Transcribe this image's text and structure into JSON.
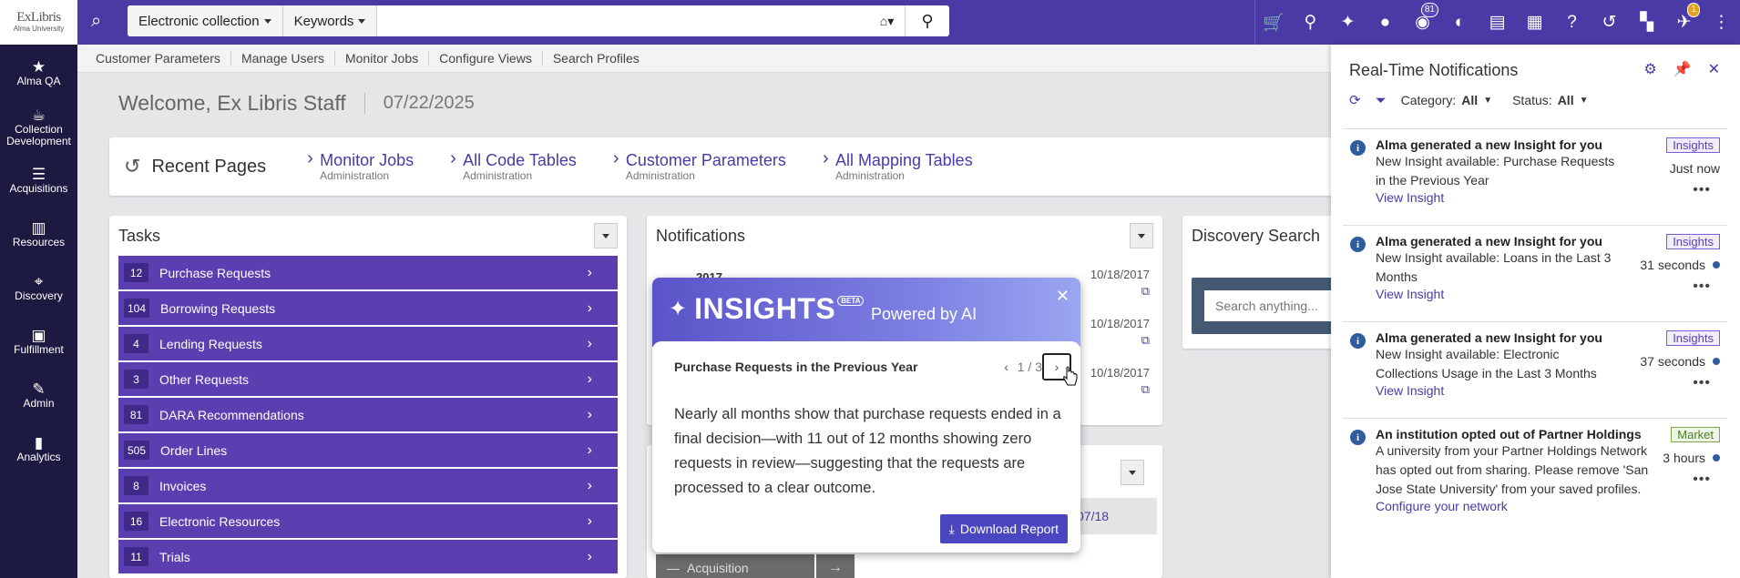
{
  "logo": {
    "line1": "ExLibris",
    "line2": "Alma University"
  },
  "search": {
    "scope": "Electronic collection",
    "field": "Keywords",
    "home": "⌂▾",
    "query": "",
    "placeholder": ""
  },
  "top_badges": {
    "tasks": "81",
    "notifications": "1"
  },
  "sidebar": {
    "items": [
      {
        "label": "Alma QA",
        "icon": "★"
      },
      {
        "label": "Collection Development",
        "icon": "☕"
      },
      {
        "label": "Acquisitions",
        "icon": "☰"
      },
      {
        "label": "Resources",
        "icon": "▥"
      },
      {
        "label": "Discovery",
        "icon": "⌖"
      },
      {
        "label": "Fulfillment",
        "icon": "▣"
      },
      {
        "label": "Admin",
        "icon": "✎"
      },
      {
        "label": "Analytics",
        "icon": "▮"
      }
    ]
  },
  "subnav": [
    "Customer Parameters",
    "Manage Users",
    "Monitor Jobs",
    "Configure Views",
    "Search Profiles"
  ],
  "welcome": {
    "text": "Welcome, Ex Libris Staff",
    "date": "07/22/2025"
  },
  "recent": {
    "title": "Recent Pages",
    "links": [
      {
        "title": "Monitor Jobs",
        "sub": "Administration"
      },
      {
        "title": "All Code Tables",
        "sub": "Administration"
      },
      {
        "title": "Customer Parameters",
        "sub": "Administration"
      },
      {
        "title": "All Mapping Tables",
        "sub": "Administration"
      }
    ]
  },
  "tasks": {
    "title": "Tasks",
    "items": [
      {
        "count": "12",
        "label": "Purchase Requests"
      },
      {
        "count": "104",
        "label": "Borrowing Requests"
      },
      {
        "count": "4",
        "label": "Lending Requests"
      },
      {
        "count": "3",
        "label": "Other Requests"
      },
      {
        "count": "81",
        "label": "DARA Recommendations"
      },
      {
        "count": "505",
        "label": "Order Lines"
      },
      {
        "count": "8",
        "label": "Invoices"
      },
      {
        "count": "16",
        "label": "Electronic Resources"
      },
      {
        "count": "11",
        "label": "Trials"
      }
    ]
  },
  "notifications": {
    "title": "Notifications",
    "year": "2017",
    "dates": [
      "10/18/2017",
      "10/18/2017",
      "10/18/2017"
    ],
    "date2": "07/18",
    "acq": "Acquisition"
  },
  "discovery": {
    "title": "Discovery Search",
    "placeholder": "Search anything..."
  },
  "insights": {
    "brand": "INSIGHTS",
    "beta": "BETA",
    "powered": "Powered by AI",
    "close": "✕",
    "subtitle": "Purchase Requests in the Previous Year",
    "page": "1 / 3",
    "body": "Nearly all months show that purchase requests ended in a final decision—with 11 out of 12 months showing zero requests in review—suggesting that the requests are processed to a clear outcome.",
    "download": "Download Report"
  },
  "rt": {
    "title": "Real-Time Notifications",
    "category_label": "Category:",
    "category_value": "All",
    "status_label": "Status:",
    "status_value": "All",
    "items": [
      {
        "head": "Alma generated a new Insight for you",
        "body": "New Insight available: Purchase Requests in the Previous Year",
        "link": "View Insight",
        "tag": "Insights",
        "time": "Just now",
        "unread": false
      },
      {
        "head": "Alma generated a new Insight for you",
        "body": "New Insight available: Loans in the Last 3 Months",
        "link": "View Insight",
        "tag": "Insights",
        "time": "31 seconds",
        "unread": true
      },
      {
        "head": "Alma generated a new Insight for you",
        "body": "New Insight available: Electronic Collections Usage in the Last 3 Months",
        "link": "View Insight",
        "tag": "Insights",
        "time": "37 seconds",
        "unread": true
      },
      {
        "head": "An institution opted out of Partner Holdings",
        "body": "A university from your Partner Holdings Network has opted out from sharing. Please remove 'San Jose State University' from your saved profiles.",
        "link": "Configure your network",
        "tag": "Market",
        "time": "3 hours",
        "unread": true
      }
    ]
  }
}
